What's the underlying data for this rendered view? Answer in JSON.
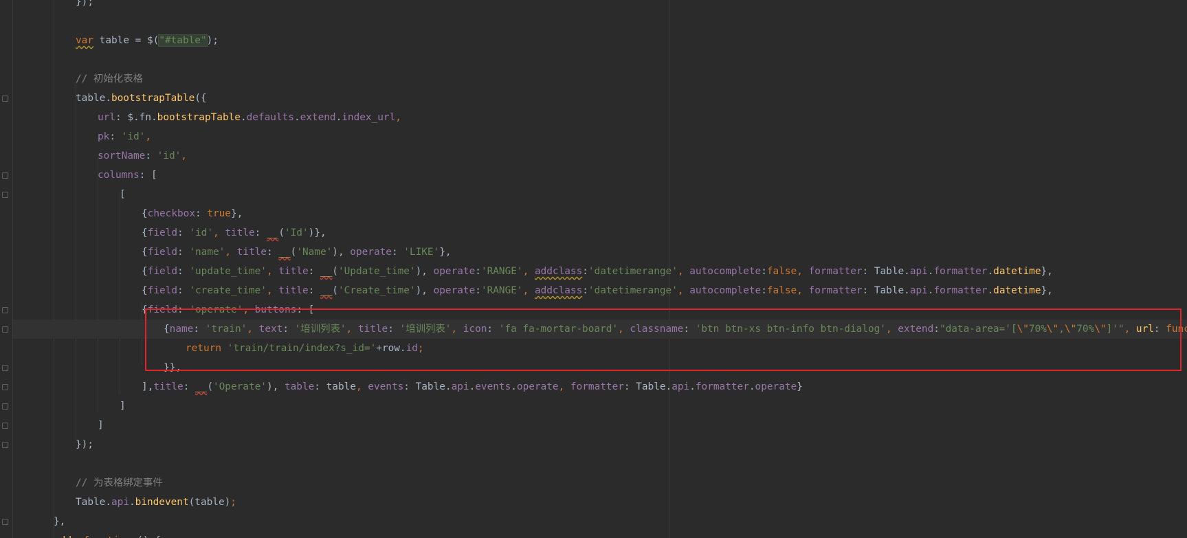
{
  "editor": {
    "language": "javascript",
    "colors": {
      "background": "#2b2b2b",
      "keyword": "#cc7832",
      "string": "#6a8759",
      "property": "#9876aa",
      "function": "#ffc66d",
      "comment": "#808080",
      "highlight_box": "#e0242a"
    }
  },
  "lines": [
    {
      "indent": 3,
      "tokens": [
        [
          "plain",
          "});"
        ]
      ]
    },
    {
      "indent": 3,
      "tokens": []
    },
    {
      "indent": 3,
      "tokens": [
        [
          "kw",
          "var",
          "squig-y"
        ],
        [
          "plain",
          " table = $("
        ],
        [
          "sel-str",
          "\"#table\""
        ],
        [
          "plain",
          ");"
        ]
      ]
    },
    {
      "indent": 3,
      "tokens": []
    },
    {
      "indent": 3,
      "tokens": [
        [
          "cm",
          "// 初始化表格"
        ]
      ]
    },
    {
      "indent": 3,
      "fold": true,
      "tokens": [
        [
          "plain",
          "table."
        ],
        [
          "fn",
          "bootstrapTable"
        ],
        [
          "plain",
          "({"
        ]
      ]
    },
    {
      "indent": 4,
      "tokens": [
        [
          "prop",
          "url"
        ],
        [
          "plain",
          ": $.fn."
        ],
        [
          "fn",
          "bootstrapTable"
        ],
        [
          "plain",
          "."
        ],
        [
          "prop",
          "defaults"
        ],
        [
          "plain",
          "."
        ],
        [
          "prop",
          "extend"
        ],
        [
          "plain",
          "."
        ],
        [
          "prop",
          "index_url"
        ],
        [
          "kw",
          ","
        ]
      ]
    },
    {
      "indent": 4,
      "tokens": [
        [
          "prop",
          "pk"
        ],
        [
          "plain",
          ": "
        ],
        [
          "str",
          "'id'"
        ],
        [
          "kw",
          ","
        ]
      ]
    },
    {
      "indent": 4,
      "tokens": [
        [
          "prop",
          "sortName"
        ],
        [
          "plain",
          ": "
        ],
        [
          "str",
          "'id'"
        ],
        [
          "kw",
          ","
        ]
      ]
    },
    {
      "indent": 4,
      "fold": true,
      "tokens": [
        [
          "prop",
          "columns"
        ],
        [
          "plain",
          ": ["
        ]
      ]
    },
    {
      "indent": 5,
      "fold": true,
      "tokens": [
        [
          "plain",
          "["
        ]
      ]
    },
    {
      "indent": 6,
      "tokens": [
        [
          "plain",
          "{"
        ],
        [
          "prop",
          "checkbox"
        ],
        [
          "plain",
          ": "
        ],
        [
          "kw",
          "true"
        ],
        [
          "plain",
          "},"
        ]
      ]
    },
    {
      "indent": 6,
      "tokens": [
        [
          "plain",
          "{"
        ],
        [
          "prop",
          "field"
        ],
        [
          "plain",
          ": "
        ],
        [
          "str",
          "'id'"
        ],
        [
          "kw",
          ","
        ],
        [
          "plain",
          " "
        ],
        [
          "prop",
          "title"
        ],
        [
          "plain",
          ": "
        ],
        [
          "fn",
          "__",
          "squig"
        ],
        [
          "plain",
          "("
        ],
        [
          "str",
          "'Id'"
        ],
        [
          "plain",
          ")},"
        ]
      ]
    },
    {
      "indent": 6,
      "tokens": [
        [
          "plain",
          "{"
        ],
        [
          "prop",
          "field"
        ],
        [
          "plain",
          ": "
        ],
        [
          "str",
          "'name'"
        ],
        [
          "kw",
          ","
        ],
        [
          "plain",
          " "
        ],
        [
          "prop",
          "title"
        ],
        [
          "plain",
          ": "
        ],
        [
          "fn",
          "__",
          "squig"
        ],
        [
          "plain",
          "("
        ],
        [
          "str",
          "'Name'"
        ],
        [
          "plain",
          "), "
        ],
        [
          "prop",
          "operate"
        ],
        [
          "plain",
          ": "
        ],
        [
          "str",
          "'LIKE'"
        ],
        [
          "plain",
          "},"
        ]
      ]
    },
    {
      "indent": 6,
      "tokens": [
        [
          "plain",
          "{"
        ],
        [
          "prop",
          "field"
        ],
        [
          "plain",
          ": "
        ],
        [
          "str",
          "'update_time'"
        ],
        [
          "kw",
          ","
        ],
        [
          "plain",
          " "
        ],
        [
          "prop",
          "title"
        ],
        [
          "plain",
          ": "
        ],
        [
          "fn",
          "__",
          "squig"
        ],
        [
          "plain",
          "("
        ],
        [
          "str",
          "'Update_time'"
        ],
        [
          "plain",
          "), "
        ],
        [
          "prop",
          "operate"
        ],
        [
          "plain",
          ":"
        ],
        [
          "str",
          "'RANGE'"
        ],
        [
          "kw",
          ","
        ],
        [
          "plain",
          " "
        ],
        [
          "prop",
          "addclass",
          "squig-y"
        ],
        [
          "plain",
          ":"
        ],
        [
          "str",
          "'datetimerange'"
        ],
        [
          "kw",
          ","
        ],
        [
          "plain",
          " "
        ],
        [
          "prop",
          "autocomplete"
        ],
        [
          "plain",
          ":"
        ],
        [
          "kw",
          "false"
        ],
        [
          "kw",
          ","
        ],
        [
          "plain",
          " "
        ],
        [
          "prop",
          "formatter"
        ],
        [
          "plain",
          ": Table."
        ],
        [
          "prop",
          "api"
        ],
        [
          "plain",
          "."
        ],
        [
          "prop",
          "formatter"
        ],
        [
          "plain",
          "."
        ],
        [
          "fn",
          "datetime"
        ],
        [
          "plain",
          "},"
        ]
      ]
    },
    {
      "indent": 6,
      "tokens": [
        [
          "plain",
          "{"
        ],
        [
          "prop",
          "field"
        ],
        [
          "plain",
          ": "
        ],
        [
          "str",
          "'create_time'"
        ],
        [
          "kw",
          ","
        ],
        [
          "plain",
          " "
        ],
        [
          "prop",
          "title"
        ],
        [
          "plain",
          ": "
        ],
        [
          "fn",
          "__",
          "squig"
        ],
        [
          "plain",
          "("
        ],
        [
          "str",
          "'Create_time'"
        ],
        [
          "plain",
          "), "
        ],
        [
          "prop",
          "operate"
        ],
        [
          "plain",
          ":"
        ],
        [
          "str",
          "'RANGE'"
        ],
        [
          "kw",
          ","
        ],
        [
          "plain",
          " "
        ],
        [
          "prop",
          "addclass",
          "squig-y"
        ],
        [
          "plain",
          ":"
        ],
        [
          "str",
          "'datetimerange'"
        ],
        [
          "kw",
          ","
        ],
        [
          "plain",
          " "
        ],
        [
          "prop",
          "autocomplete"
        ],
        [
          "plain",
          ":"
        ],
        [
          "kw",
          "false"
        ],
        [
          "kw",
          ","
        ],
        [
          "plain",
          " "
        ],
        [
          "prop",
          "formatter"
        ],
        [
          "plain",
          ": Table."
        ],
        [
          "prop",
          "api"
        ],
        [
          "plain",
          "."
        ],
        [
          "prop",
          "formatter"
        ],
        [
          "plain",
          "."
        ],
        [
          "fn",
          "datetime"
        ],
        [
          "plain",
          "},"
        ]
      ]
    },
    {
      "indent": 6,
      "fold": true,
      "tokens": [
        [
          "plain",
          "{"
        ],
        [
          "prop",
          "field"
        ],
        [
          "plain",
          ": "
        ],
        [
          "str",
          "'operate'"
        ],
        [
          "kw",
          ","
        ],
        [
          "plain",
          " "
        ],
        [
          "prop",
          "buttons"
        ],
        [
          "plain",
          ": ["
        ]
      ]
    },
    {
      "indent": 7,
      "current": true,
      "fold": true,
      "tokens": [
        [
          "plain",
          "{"
        ],
        [
          "prop",
          "name"
        ],
        [
          "plain",
          ": "
        ],
        [
          "str",
          "'train'"
        ],
        [
          "kw",
          ","
        ],
        [
          "plain",
          " "
        ],
        [
          "prop",
          "text"
        ],
        [
          "plain",
          ": "
        ],
        [
          "str",
          "'培训列表'"
        ],
        [
          "kw",
          ","
        ],
        [
          "plain",
          " "
        ],
        [
          "prop",
          "title"
        ],
        [
          "plain",
          ": "
        ],
        [
          "str",
          "'培训列表'"
        ],
        [
          "kw",
          ","
        ],
        [
          "plain",
          " "
        ],
        [
          "prop",
          "icon"
        ],
        [
          "plain",
          ": "
        ],
        [
          "str",
          "'fa fa-mortar-board'"
        ],
        [
          "kw",
          ","
        ],
        [
          "plain",
          " "
        ],
        [
          "prop",
          "classname"
        ],
        [
          "plain",
          ": "
        ],
        [
          "str",
          "'btn btn-xs btn-info btn-dialog'"
        ],
        [
          "kw",
          ","
        ],
        [
          "plain",
          " "
        ],
        [
          "prop",
          "extend"
        ],
        [
          "plain",
          ":"
        ],
        [
          "str",
          "\"data-area='["
        ],
        [
          "kw",
          "\\\""
        ],
        [
          "str",
          "70%"
        ],
        [
          "kw",
          "\\\""
        ],
        [
          "str",
          ","
        ],
        [
          "kw",
          "\\\""
        ],
        [
          "str",
          "70%"
        ],
        [
          "kw",
          "\\\""
        ],
        [
          "str",
          "]'\""
        ],
        [
          "kw",
          ","
        ],
        [
          "plain",
          " "
        ],
        [
          "fn",
          "url"
        ],
        [
          "plain",
          ": "
        ],
        [
          "kw",
          "function"
        ],
        [
          "plain",
          "(row) {"
        ]
      ]
    },
    {
      "indent": 8,
      "tokens": [
        [
          "kw",
          "return"
        ],
        [
          "plain",
          " "
        ],
        [
          "str",
          "'train/train/index?s_id='"
        ],
        [
          "plain",
          "+row."
        ],
        [
          "prop",
          "id"
        ],
        [
          "kw",
          ";"
        ]
      ]
    },
    {
      "indent": 7,
      "fold": true,
      "tokens": [
        [
          "plain",
          "}},"
        ]
      ]
    },
    {
      "indent": 6,
      "fold": true,
      "tokens": [
        [
          "plain",
          "],"
        ],
        [
          "prop",
          "title"
        ],
        [
          "plain",
          ": "
        ],
        [
          "fn",
          "__",
          "squig"
        ],
        [
          "plain",
          "("
        ],
        [
          "str",
          "'Operate'"
        ],
        [
          "plain",
          "), "
        ],
        [
          "prop",
          "table"
        ],
        [
          "plain",
          ": table"
        ],
        [
          "kw",
          ","
        ],
        [
          "plain",
          " "
        ],
        [
          "prop",
          "events"
        ],
        [
          "plain",
          ": Table."
        ],
        [
          "prop",
          "api"
        ],
        [
          "plain",
          "."
        ],
        [
          "prop",
          "events"
        ],
        [
          "plain",
          "."
        ],
        [
          "prop",
          "operate"
        ],
        [
          "kw",
          ","
        ],
        [
          "plain",
          " "
        ],
        [
          "prop",
          "formatter"
        ],
        [
          "plain",
          ": Table."
        ],
        [
          "prop",
          "api"
        ],
        [
          "plain",
          "."
        ],
        [
          "prop",
          "formatter"
        ],
        [
          "plain",
          "."
        ],
        [
          "prop",
          "operate"
        ],
        [
          "plain",
          "}"
        ]
      ]
    },
    {
      "indent": 5,
      "fold": true,
      "tokens": [
        [
          "plain",
          "]"
        ]
      ]
    },
    {
      "indent": 4,
      "fold": true,
      "tokens": [
        [
          "plain",
          "]"
        ]
      ]
    },
    {
      "indent": 3,
      "fold": true,
      "tokens": [
        [
          "plain",
          "});"
        ]
      ]
    },
    {
      "indent": 3,
      "tokens": []
    },
    {
      "indent": 3,
      "tokens": [
        [
          "cm",
          "// 为表格绑定事件"
        ]
      ]
    },
    {
      "indent": 3,
      "tokens": [
        [
          "plain",
          "Table."
        ],
        [
          "prop",
          "api"
        ],
        [
          "plain",
          "."
        ],
        [
          "fn",
          "bindevent"
        ],
        [
          "plain",
          "(table)"
        ],
        [
          "kw",
          ";"
        ]
      ]
    },
    {
      "indent": 2,
      "fold": true,
      "tokens": [
        [
          "plain",
          "},"
        ]
      ]
    },
    {
      "indent": 2,
      "fold": true,
      "tokens": [
        [
          "fn",
          "add"
        ],
        [
          "plain",
          ": "
        ],
        [
          "kw",
          "function"
        ],
        [
          "plain",
          " () {"
        ]
      ]
    }
  ]
}
